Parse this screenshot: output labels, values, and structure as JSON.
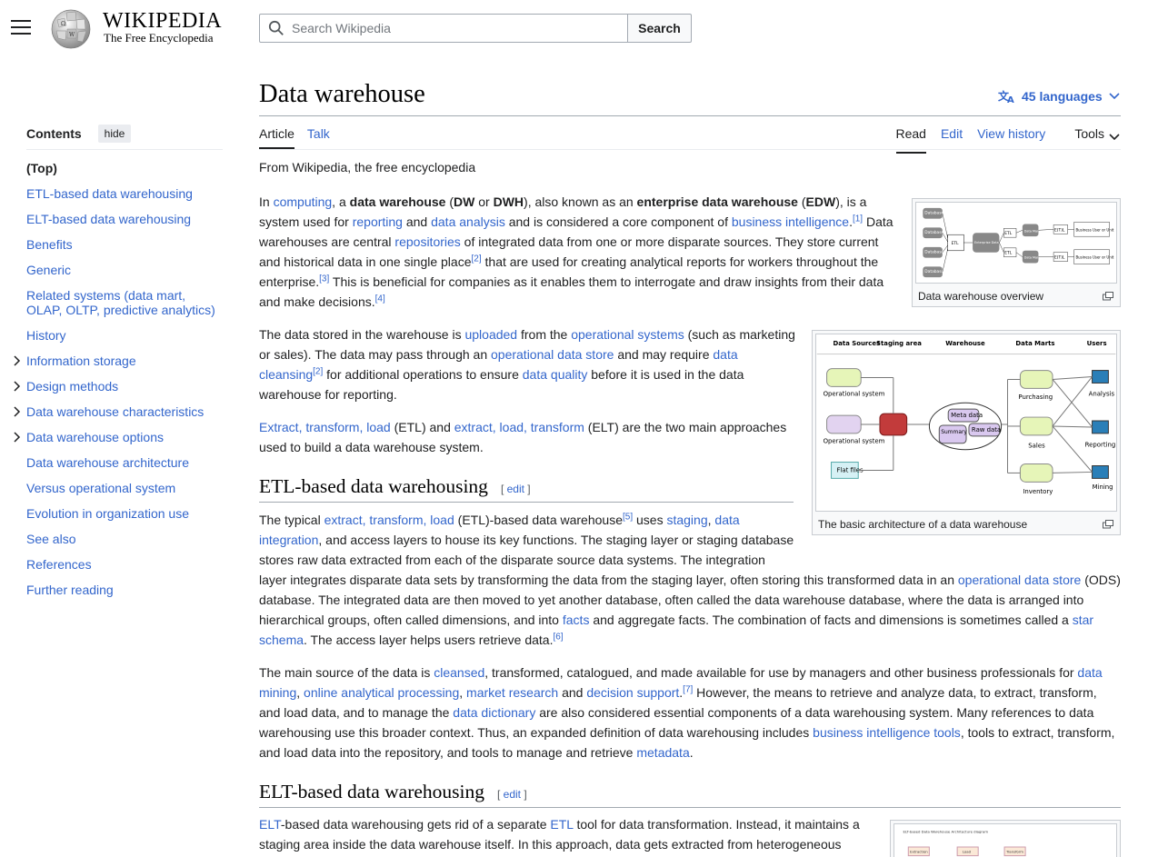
{
  "header": {
    "logo_word": "WIKIPEDIA",
    "logo_tagline": "The Free Encyclopedia",
    "search_placeholder": "Search Wikipedia",
    "search_button": "Search"
  },
  "toc": {
    "title": "Contents",
    "hide": "hide",
    "items": [
      {
        "label": "(Top)"
      },
      {
        "label": "ETL-based data warehousing"
      },
      {
        "label": "ELT-based data warehousing"
      },
      {
        "label": "Benefits"
      },
      {
        "label": "Generic"
      },
      {
        "label": "Related systems (data mart, OLAP, OLTP, predictive analytics)"
      },
      {
        "label": "History"
      },
      {
        "label": "Information storage"
      },
      {
        "label": "Design methods"
      },
      {
        "label": "Data warehouse characteristics"
      },
      {
        "label": "Data warehouse options"
      },
      {
        "label": "Data warehouse architecture"
      },
      {
        "label": "Versus operational system"
      },
      {
        "label": "Evolution in organization use"
      },
      {
        "label": "See also"
      },
      {
        "label": "References"
      },
      {
        "label": "Further reading"
      }
    ]
  },
  "article": {
    "title": "Data warehouse",
    "languages": "45 languages",
    "tabs": {
      "article": "Article",
      "talk": "Talk",
      "read": "Read",
      "edit": "Edit",
      "history": "View history",
      "tools": "Tools"
    },
    "tagline": "From Wikipedia, the free encyclopedia",
    "sections": {
      "etl": {
        "heading": "ETL-based data warehousing",
        "edit": "edit"
      },
      "elt": {
        "heading": "ELT-based data warehousing",
        "edit": "edit"
      }
    },
    "figures": {
      "overview": {
        "caption": "Data warehouse overview",
        "labels": {
          "database": "Database",
          "etl": "ETL",
          "edw": "Enterprise Data Warehouse",
          "data_mart": "Data Mart",
          "etl_e": "E(T)L",
          "business": "Business User or Unit"
        }
      },
      "architecture": {
        "caption": "The basic architecture of a data warehouse",
        "labels": {
          "data_sources": "Data Sources",
          "staging": "Staging area",
          "warehouse": "Warehouse",
          "data_marts": "Data Marts",
          "users": "Users",
          "operational_system": "Operational system",
          "flat_files": "Flat files",
          "meta_data": "Meta data",
          "summary_data": "Summary data",
          "raw_data": "Raw data",
          "purchasing": "Purchasing",
          "sales": "Sales",
          "inventory": "Inventory",
          "analysis": "Analysis",
          "reporting": "Reporting",
          "mining": "Mining"
        }
      },
      "elt_diagram": {
        "caption": "ELT-based Data Warehouse Architecture diagram",
        "labels": {
          "ingestion": "Extraction",
          "load": "Load",
          "transform": "Transform"
        }
      }
    }
  },
  "colors": {
    "link": "#3366cc",
    "text": "#202122",
    "border": "#a2a9b1"
  }
}
